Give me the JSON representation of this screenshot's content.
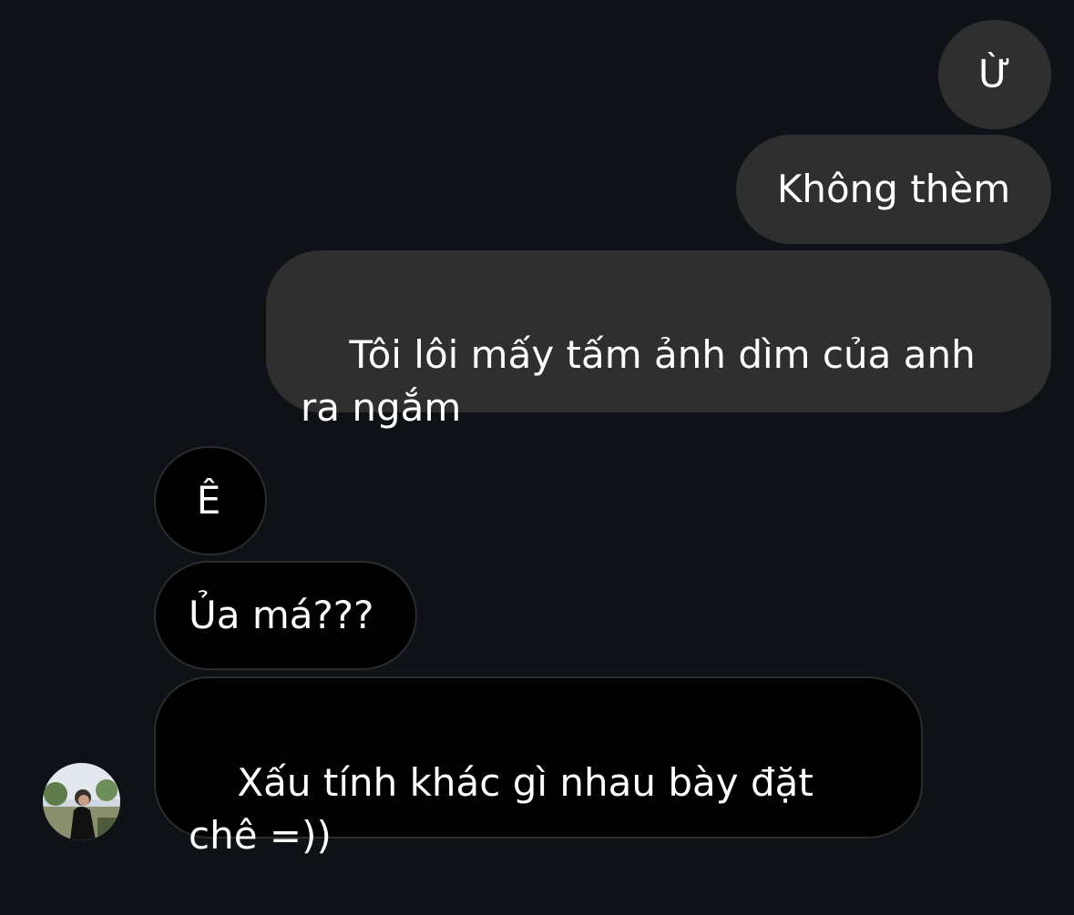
{
  "conversation": {
    "messages": [
      {
        "direction": "sent",
        "text": "Ừ"
      },
      {
        "direction": "sent",
        "text": "Không thèm"
      },
      {
        "direction": "sent",
        "text": "Tôi lôi mấy tấm ảnh dìm của anh ra ngắm"
      },
      {
        "direction": "received",
        "text": "Ê"
      },
      {
        "direction": "received",
        "text": "Ủa má???"
      },
      {
        "direction": "received",
        "text": "Xấu tính khác gì nhau bày đặt chê =))"
      }
    ],
    "contact_avatar": "contact-avatar-photo"
  },
  "colors": {
    "background": "#0e1116",
    "sent_bubble": "#2f2f2f",
    "received_bubble": "#000000",
    "received_border": "#2a2c30",
    "text": "#ffffff"
  }
}
